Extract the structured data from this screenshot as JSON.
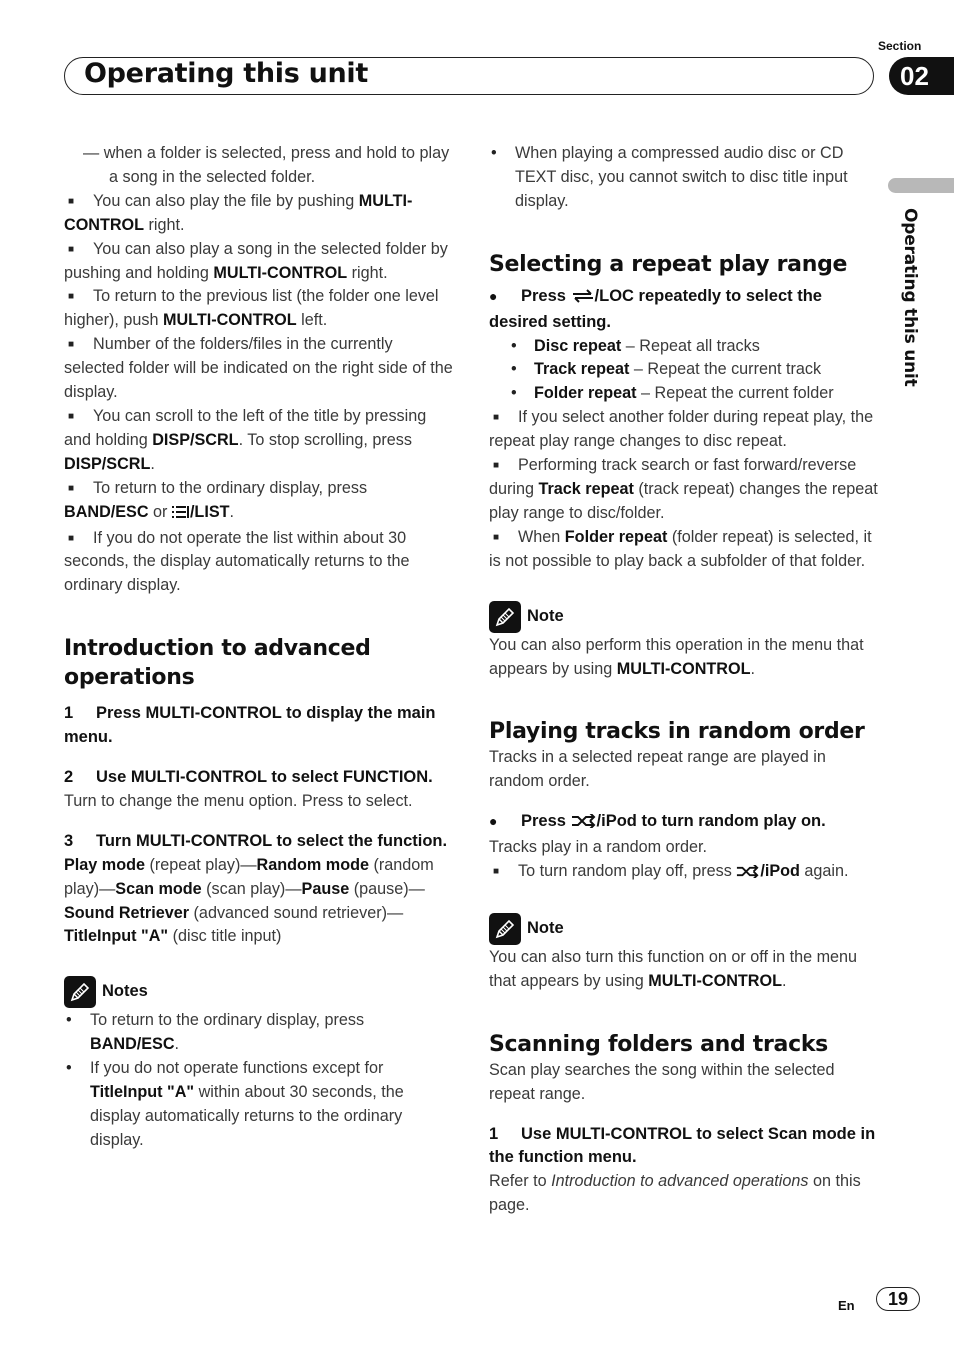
{
  "header": {
    "title": "Operating this unit",
    "section_label": "Section",
    "section_number": "02",
    "side_label": "Operating this unit"
  },
  "left": {
    "dash_item": "when a folder is selected, press and hold to play a song in the selected folder.",
    "bullets": [
      {
        "pre": "You can also play the file by pushing ",
        "bold": "MULTI-CONTROL",
        "post": " right."
      },
      {
        "pre": "You can also play a song in the selected folder by pushing and holding ",
        "bold": "MULTI-CONTROL",
        "post": " right."
      },
      {
        "pre": "To return to the previous list (the folder one level higher), push ",
        "bold": "MULTI-CONTROL",
        "post": " left."
      },
      {
        "pre": "Number of the folders/files in the currently selected folder will be indicated on the right side of the display.",
        "bold": "",
        "post": ""
      },
      {
        "pre": "You can scroll to the left of the title by pressing and holding ",
        "bold": "DISP/SCRL",
        "post": ". To stop scrolling, press ",
        "bold2": "DISP/SCRL",
        "post2": "."
      },
      {
        "pre": "To return to the ordinary display, press ",
        "bold": "BAND/ESC",
        "mid": " or ",
        "icon": "list-icon",
        "bold2": "/LIST",
        "post2": "."
      },
      {
        "pre": "If you do not operate the list within about 30 seconds, the display automatically returns to the ordinary display.",
        "bold": "",
        "post": ""
      }
    ],
    "intro_heading": "Introduction to advanced operations",
    "steps": [
      {
        "num": "1",
        "text": "Press MULTI-CONTROL to display the main menu."
      },
      {
        "num": "2",
        "text": "Use MULTI-CONTROL to select FUNCTION.",
        "desc": "Turn to change the menu option. Press to select."
      },
      {
        "num": "3",
        "text": "Turn MULTI-CONTROL to select the function."
      }
    ],
    "functions": [
      {
        "name": "Play mode",
        "desc": " (repeat play)—"
      },
      {
        "name": "Random mode",
        "desc": " (random play)—"
      },
      {
        "name": "Scan mode",
        "desc": " (scan play)—"
      },
      {
        "name": "Pause",
        "desc": " (pause)—"
      },
      {
        "name": "Sound Retriever",
        "desc": " (advanced sound retriever)—"
      },
      {
        "name": "TitleInput \"A\"",
        "desc": " (disc title input)"
      }
    ],
    "notes_title": "Notes",
    "notes": [
      {
        "pre": "To return to the ordinary display, press ",
        "bold": "BAND/ESC",
        "post": "."
      },
      {
        "pre": "If you do not operate functions except for ",
        "bold": "TitleInput \"A\"",
        "post": " within about 30 seconds, the display automatically returns to the ordinary display."
      }
    ]
  },
  "right": {
    "top_note": "When playing a compressed audio disc or CD TEXT disc, you cannot switch to disc title input display.",
    "repeat": {
      "heading": "Selecting a repeat play range",
      "step_pre": "Press ",
      "step_icon": "repeat-icon",
      "step_post": "/LOC repeatedly to select the desired setting.",
      "options": [
        {
          "name": "Disc repeat",
          "desc": " – Repeat all tracks"
        },
        {
          "name": "Track repeat",
          "desc": " – Repeat the current track"
        },
        {
          "name": "Folder repeat",
          "desc": " – Repeat the current folder"
        }
      ],
      "bullets": [
        {
          "pre": "If you select another folder during repeat play, the repeat play range changes to disc repeat.",
          "bold": "",
          "post": ""
        },
        {
          "pre": "Performing track search or fast forward/reverse during ",
          "bold": "Track repeat",
          "post": " (track repeat) changes the repeat play range to disc/folder."
        },
        {
          "pre": "When ",
          "bold": "Folder repeat",
          "post": " (folder repeat) is selected, it is not possible to play back a subfolder of that folder."
        }
      ],
      "note_title": "Note",
      "note_pre": "You can also perform this operation in the menu that appears by using ",
      "note_bold": "MULTI-CONTROL",
      "note_post": "."
    },
    "random": {
      "heading": "Playing tracks in random order",
      "intro": "Tracks in a selected repeat range are played in random order.",
      "step_pre": "Press ",
      "step_icon": "shuffle-icon",
      "step_post": "/iPod to turn random play on.",
      "step_desc": "Tracks play in a random order.",
      "bullet_pre": "To turn random play off, press ",
      "bullet_bold": "/iPod",
      "bullet_post": " again.",
      "note_title": "Note",
      "note_pre": "You can also turn this function on or off in the menu that appears by using ",
      "note_bold": "MULTI-CONTROL",
      "note_post": "."
    },
    "scan": {
      "heading": "Scanning folders and tracks",
      "intro": "Scan play searches the song within the selected repeat range.",
      "step_num": "1",
      "step_text": "Use MULTI-CONTROL to select Scan mode in the function menu.",
      "desc_pre": "Refer to ",
      "desc_italic": "Introduction to advanced operations",
      "desc_post": " on this page."
    }
  },
  "footer": {
    "lang": "En",
    "page": "19"
  }
}
